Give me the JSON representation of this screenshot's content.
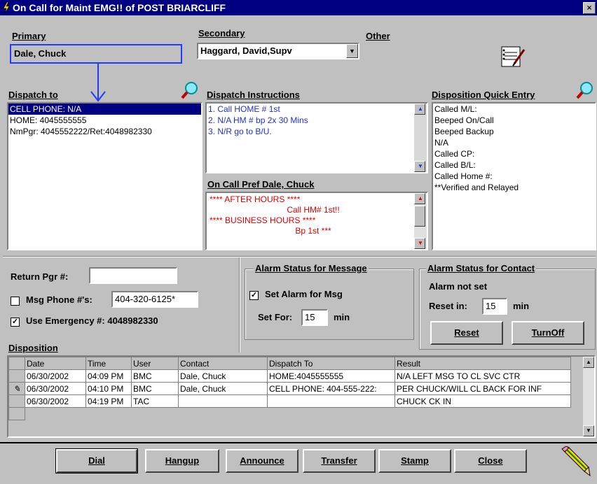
{
  "window": {
    "title": "On Call for Maint EMG!! of POST BRIARCLIFF",
    "close": "×"
  },
  "labels": {
    "primary": "Primary",
    "secondary": "Secondary",
    "other": "Other",
    "dispatch_to": "Dispatch to",
    "dispatch_instructions": "Dispatch Instructions",
    "disposition_quick_entry": "Disposition Quick Entry",
    "on_call_pref": "On Call Pref Dale, Chuck",
    "return_pgr": "Return Pgr #:",
    "msg_phone": "Msg Phone #'s:",
    "use_emergency": "Use Emergency #: 4048982330",
    "disposition": "Disposition"
  },
  "primary_value": "Dale, Chuck",
  "secondary_value": "Haggard, David,Supv",
  "dispatch_to_items": [
    "CELL PHONE: N/A",
    "HOME: 4045555555",
    "NmPgr: 4045552222/Ret:4048982330"
  ],
  "dispatch_instructions": [
    "1. Call HOME # 1st",
    "2. N/A  HM # bp 2x 30 Mins",
    "3.  N/R go to B/U."
  ],
  "on_call_pref_lines": [
    "**** AFTER HOURS ****",
    "Call HM# 1st!!",
    "**** BUSINESS HOURS ****",
    "Bp 1st ***"
  ],
  "quick_entry_items": [
    "Called M/L:",
    "Beeped On/Call",
    "Beeped Backup",
    "N/A",
    "Called CP:",
    "Called B/L:",
    "Called Home #:",
    "**Verified and Relayed"
  ],
  "return_pgr_value": "",
  "msg_phone_value": "404-320-6125*",
  "msg_phone_checked": false,
  "use_emergency_checked": true,
  "alarm_msg": {
    "title": "Alarm Status for Message",
    "set_alarm_label": "Set Alarm for Msg",
    "set_alarm_checked": true,
    "set_for_label": "Set For:",
    "set_for_value": "15",
    "unit": "min"
  },
  "alarm_contact": {
    "title": "Alarm Status for Contact",
    "status": "Alarm not set",
    "reset_label": "Reset in:",
    "reset_value": "15",
    "unit": "min",
    "reset_button": "Reset",
    "turnoff_button": "TurnOff"
  },
  "disposition_table": {
    "columns": [
      "Date",
      "Time",
      "User",
      "Contact",
      "Dispatch To",
      "Result"
    ],
    "rows": [
      {
        "marker": "",
        "cells": [
          "06/30/2002",
          "04:09 PM",
          "BMC",
          "Dale, Chuck",
          "HOME:4045555555",
          "N/A LEFT MSG TO CL SVC CTR"
        ]
      },
      {
        "marker": "✎",
        "cells": [
          "06/30/2002",
          "04:10 PM",
          "BMC",
          "Dale, Chuck",
          "CELL PHONE: 404-555-222:",
          "PER CHUCK/WILL CL BACK FOR INF"
        ]
      },
      {
        "marker": "",
        "cells": [
          "06/30/2002",
          "04:19 PM",
          "TAC",
          "",
          "",
          "CHUCK CK IN"
        ]
      }
    ]
  },
  "buttons": {
    "dial": "Dial",
    "hangup": "Hangup",
    "announce": "Announce",
    "transfer": "Transfer",
    "stamp": "Stamp",
    "close": "Close"
  },
  "icons": {
    "title": "lightning-icon",
    "search1": "magnifier-icon",
    "search2": "magnifier-icon",
    "notepad": "notepad-icon",
    "pencil": "pencil-icon"
  }
}
